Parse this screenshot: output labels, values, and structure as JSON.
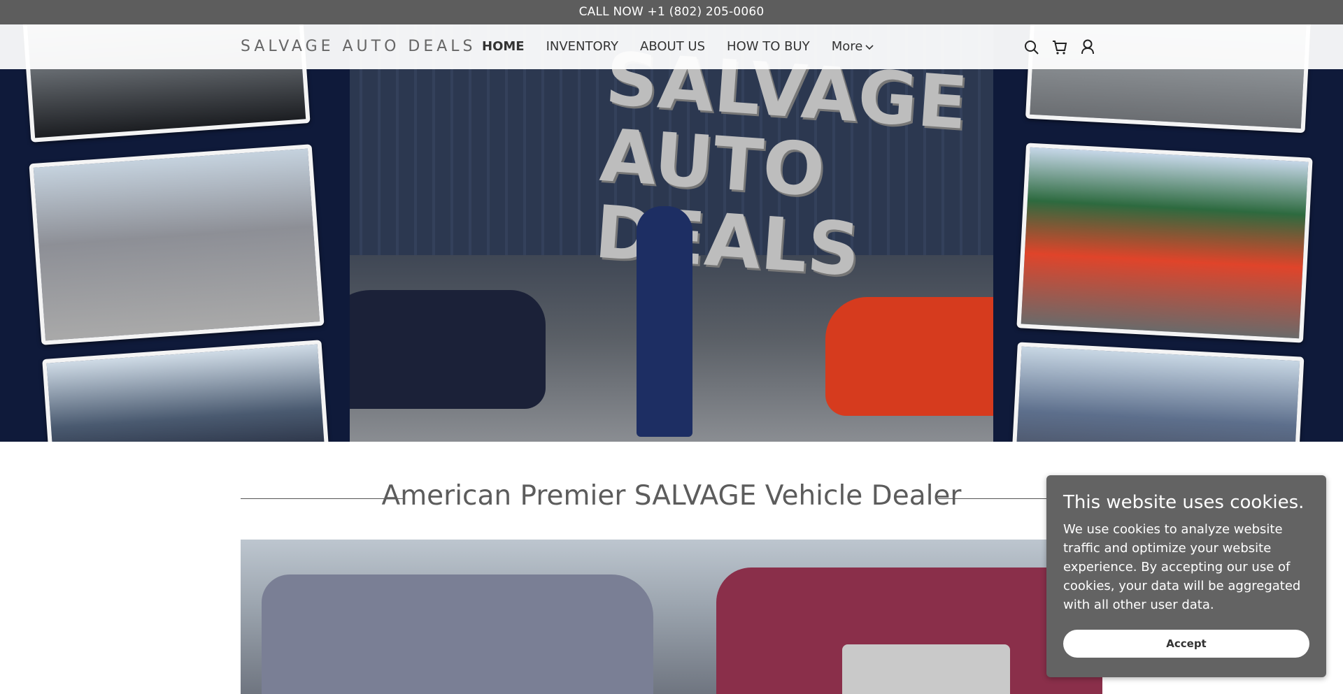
{
  "topbar": {
    "text": "CALL NOW +1 (802) 205-0060"
  },
  "nav": {
    "brand": "SALVAGE AUTO DEALS",
    "items": [
      {
        "label": "HOME",
        "active": true
      },
      {
        "label": "INVENTORY",
        "active": false
      },
      {
        "label": "ABOUT US",
        "active": false
      },
      {
        "label": "HOW TO BUY",
        "active": false
      },
      {
        "label": "More",
        "active": false
      }
    ],
    "icons": [
      "search-icon",
      "cart-icon",
      "account-icon"
    ]
  },
  "hero": {
    "sign_line1": "SALVAGE",
    "sign_line2": "AUTO DEALS"
  },
  "section": {
    "title": "American Premier SALVAGE Vehicle Dealer"
  },
  "cookie": {
    "title": "This website uses cookies.",
    "body": "We use cookies to analyze website traffic and optimize your website experience. By accepting our use of cookies, your data will be aggregated with all other user data.",
    "accept_label": "Accept"
  },
  "colors": {
    "topbar": "#5d5d5d",
    "cookie_bg": "#636363",
    "title_text": "#5c5c5c"
  }
}
